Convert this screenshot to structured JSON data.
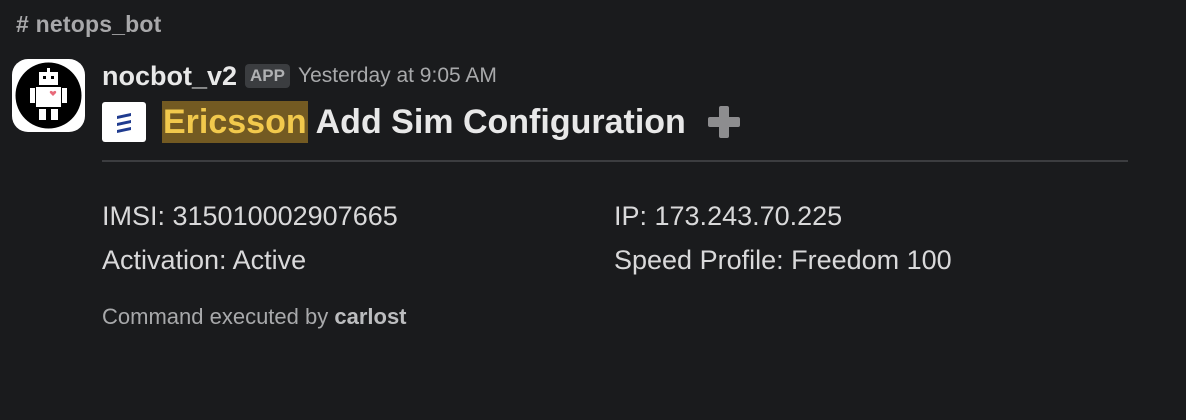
{
  "channel": {
    "hash": "#",
    "name": "netops_bot"
  },
  "message": {
    "bot_name": "nocbot_v2",
    "badge": "APP",
    "timestamp": "Yesterday at 9:05 AM",
    "avatar_icon": "robot-icon",
    "title": {
      "logo_icon": "ericsson-logo-icon",
      "highlight": "Ericsson",
      "text": "Add Sim Configuration",
      "emoji_icon": "heavy-plus-icon"
    },
    "fields": {
      "imsi": "IMSI: 315010002907665",
      "ip": "IP: 173.243.70.225",
      "activation": "Activation: Active",
      "speed_profile": "Speed Profile: Freedom 100"
    },
    "footer": {
      "prefix": "Command executed by",
      "user": "carlost"
    }
  },
  "colors": {
    "background": "#1a1b1d",
    "highlight_bg": "#735a22",
    "highlight_text": "#f2c94c",
    "ericsson_blue": "#1f3b8f"
  }
}
